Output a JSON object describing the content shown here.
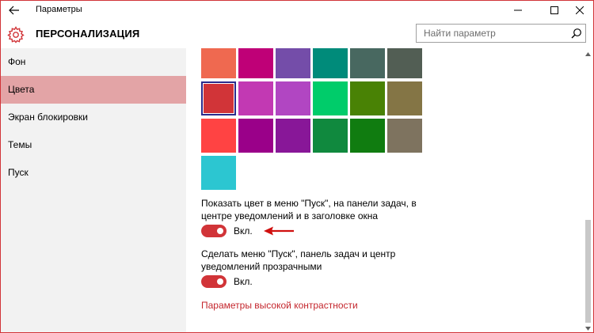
{
  "window": {
    "title": "Параметры"
  },
  "header": {
    "section_title": "ПЕРСОНАЛИЗАЦИЯ",
    "search_placeholder": "Найти параметр"
  },
  "sidebar": {
    "items": [
      {
        "label": "Фон",
        "active": false
      },
      {
        "label": "Цвета",
        "active": true
      },
      {
        "label": "Экран блокировки",
        "active": false
      },
      {
        "label": "Темы",
        "active": false
      },
      {
        "label": "Пуск",
        "active": false
      }
    ]
  },
  "colors": {
    "accent": "#d13438",
    "selected_swatch": "#d13438",
    "swatches": [
      "#ef6950",
      "#bf0077",
      "#744da9",
      "#008b7a",
      "#486860",
      "#525e54",
      "#d13438",
      "#c239b3",
      "#b146c2",
      "#00cc6a",
      "#498205",
      "#847545",
      "#ff4343",
      "#9a0089",
      "#881798",
      "#10893e",
      "#107c10",
      "#7e735f",
      "#2cc6d1"
    ]
  },
  "options": {
    "show_color": {
      "text": "Показать цвет в меню \"Пуск\", на панели задач, в центре уведомлений и в заголовке окна",
      "toggle_label": "Вкл.",
      "on": true
    },
    "transparency": {
      "text": "Сделать меню \"Пуск\", панель задач и центр уведомлений прозрачными",
      "toggle_label": "Вкл.",
      "on": true
    },
    "high_contrast_link": "Параметры высокой контрастности"
  }
}
